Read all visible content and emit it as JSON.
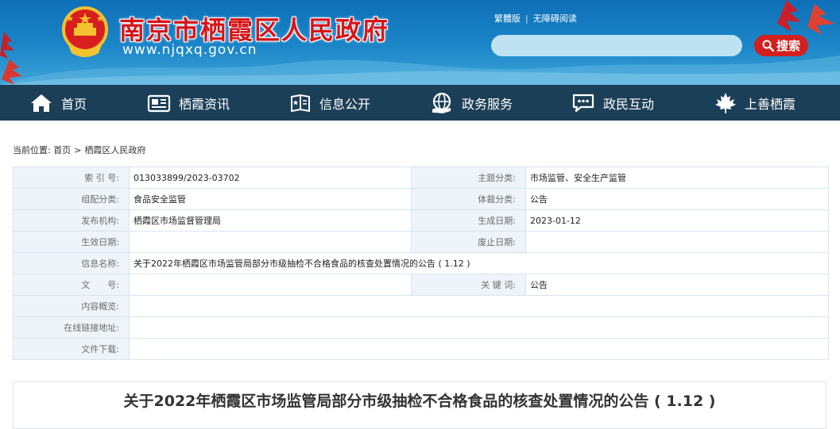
{
  "header": {
    "site_title": "南京市栖霞区人民政府",
    "site_url": "www.njqxq.gov.cn",
    "links": [
      "繁體版",
      "无障碍阅读"
    ],
    "search": {
      "placeholder": "",
      "button_label": "搜索"
    }
  },
  "nav": {
    "items": [
      {
        "label": "首页",
        "icon": "home-icon"
      },
      {
        "label": "栖霞资讯",
        "icon": "news-icon"
      },
      {
        "label": "信息公开",
        "icon": "info-icon"
      },
      {
        "label": "政务服务",
        "icon": "service-icon"
      },
      {
        "label": "政民互动",
        "icon": "chat-icon"
      },
      {
        "label": "上善栖霞",
        "icon": "maple-leaf-icon"
      }
    ]
  },
  "breadcrumb": {
    "prefix": "当前位置:",
    "items": [
      "首页",
      "栖霞区人民政府"
    ],
    "separator": ">"
  },
  "meta_table": {
    "index_label": "索 引 号:",
    "index_value": "013033899/2023-03702",
    "topic_label": "主题分类:",
    "topic_value": "市场监管、安全生产监管",
    "category_label": "组配分类:",
    "category_value": "食品安全监管",
    "genre_label": "体裁分类:",
    "genre_value": "公告",
    "publisher_label": "发布机构:",
    "publisher_value": "栖霞区市场监督管理局",
    "created_label": "生成日期:",
    "created_value": "2023-01-12",
    "effective_label": "生效日期:",
    "effective_value": "",
    "abolish_label": "废止日期:",
    "abolish_value": "",
    "name_label": "信息名称:",
    "name_value": "关于2022年栖霞区市场监管局部分市级抽检不合格食品的核查处置情况的公告 ( 1.12 )",
    "doc_no_label": "文　　号:",
    "doc_no_value": "",
    "keyword_label": "关 键 词:",
    "keyword_value": "公告",
    "summary_label": "内容概览:",
    "summary_value": "",
    "link_label": "在线链接地址:",
    "link_value": "",
    "download_label": "文件下载:",
    "download_value": ""
  },
  "article": {
    "title": "关于2022年栖霞区市场监管局部分市级抽检不合格食品的核查处置情况的公告 ( 1.12 )"
  },
  "colors": {
    "header_blue": "#1b86c8",
    "nav_bg": "#1c3f58",
    "title_red": "#d4171b",
    "search_red": "#d3201f"
  }
}
